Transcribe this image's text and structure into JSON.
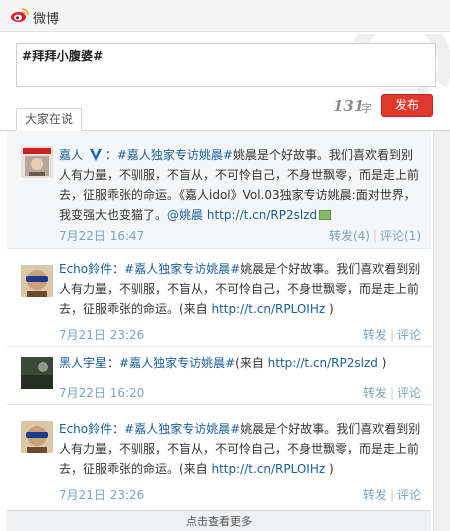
{
  "header": {
    "brand": "微博",
    "logo_icon": "weibo-logo-icon"
  },
  "composer": {
    "text": "#拜拜小腹婆#",
    "char_count": "131",
    "char_unit": "字",
    "post_label": "发布"
  },
  "tabs": [
    {
      "label": "大家在说"
    }
  ],
  "feed": [
    {
      "author": "嘉人",
      "verified_icon": "verified-v-icon",
      "colon": "：",
      "topic": "#嘉人独家专访姚晨#",
      "text": "姚晨是个好故事。我们喜欢看到别人有力量，不驯服，不盲从，不可怜自己，不身世飘零，而是走上前去，征服乖张的命运。《嘉人idol》Vol.03独家专访姚晨:面对世界，我变强大也变猫了。",
      "mention": "@姚晨",
      "link": "http://t.cn/RP2slzd",
      "image_icon": "image-attachment-icon",
      "time": "7月22日 16:47",
      "repost": "转发(4)",
      "comment": "评论(1)"
    },
    {
      "author": "Echo鈴件",
      "colon": "：",
      "topic": "#嘉人独家专访姚晨#",
      "text": "姚晨是个好故事。我们喜欢看到别人有力量，不驯服，不盲从，不可怜自己，不身世飘零，而是走上前去，征服乖张的命运。(来自 ",
      "link": "http://t.cn/RPLOIHz",
      "after": " )",
      "time": "7月21日 23:26",
      "repost": "转发",
      "comment": "评论"
    },
    {
      "author": "黑人宇星",
      "colon": "：",
      "topic": "#嘉人独家专访姚晨#",
      "text": "(来自 ",
      "link": "http://t.cn/RP2slzd",
      "after": " )",
      "time": "7月22日 16:20",
      "repost": "转发",
      "comment": "评论"
    },
    {
      "author": "Echo鈴件",
      "colon": "：",
      "topic": "#嘉人独家专访姚晨#",
      "text": "姚晨是个好故事。我们喜欢看到别人有力量，不驯服，不盲从，不可怜自己，不身世飘零，而是走上前去，征服乖张的命运。(来自 ",
      "link": "http://t.cn/RPLOIHz",
      "after": " )",
      "time": "7月21日 23:26",
      "repost": "转发",
      "comment": "评论"
    }
  ],
  "load_more": "点击查看更多",
  "colors": {
    "accent": "#e0382c",
    "link": "#1a5e9a",
    "meta": "#7aa3c4"
  }
}
